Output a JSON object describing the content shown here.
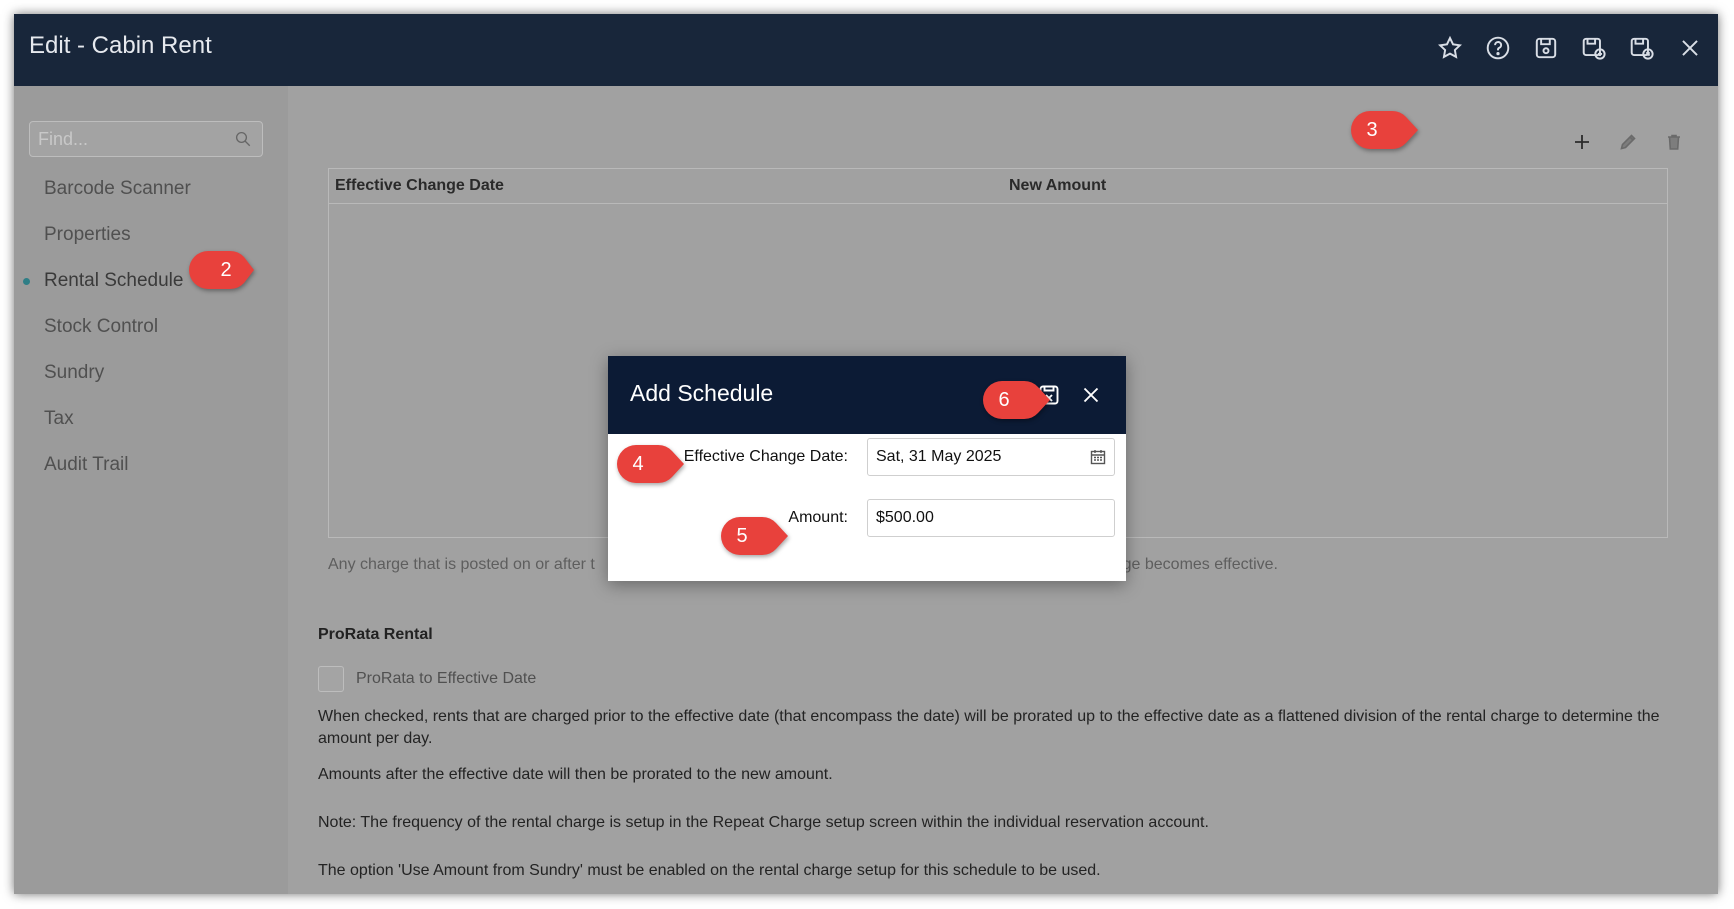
{
  "window": {
    "title": "Edit - Cabin Rent",
    "icons": [
      "star-icon",
      "help-icon",
      "save-icon",
      "save-and-new-icon",
      "save-and-close-icon",
      "close-icon"
    ]
  },
  "sidebar": {
    "search": {
      "placeholder": "Find...",
      "value": ""
    },
    "items": [
      {
        "label": "Barcode Scanner",
        "active": false
      },
      {
        "label": "Properties",
        "active": false
      },
      {
        "label": "Rental Schedule",
        "active": true
      },
      {
        "label": "Stock Control",
        "active": false
      },
      {
        "label": "Sundry",
        "active": false
      },
      {
        "label": "Tax",
        "active": false
      },
      {
        "label": "Audit Trail",
        "active": false
      }
    ]
  },
  "schedule_table": {
    "columns": [
      "Effective Change Date",
      "New Amount"
    ],
    "rows": [],
    "hint_left": "Any charge that is posted on or after t",
    "hint_right": "ent charge becomes effective."
  },
  "prorata": {
    "section_title": "ProRata Rental",
    "checkbox_label": "ProRata to Effective Date",
    "checked": false,
    "description": "When checked, rents that are charged prior to the effective date (that encompass the date) will be prorated up to the effective date as a flattened division of the rental charge to determine the amount per day.",
    "after_note": "Amounts after the effective date will then be prorated to the new amount.",
    "frequency_note": "Note: The frequency of the rental charge is setup in the Repeat Charge setup screen within the individual reservation account.",
    "sundry_note": "The option 'Use Amount from Sundry' must be enabled on the rental charge setup for this schedule to be used."
  },
  "modal": {
    "title": "Add Schedule",
    "date_label": "Effective Change Date:",
    "date_value": "Sat, 31 May 2025",
    "amount_label": "Amount:",
    "amount_value": "$500.00"
  },
  "callouts": {
    "c2": "2",
    "c3": "3",
    "c4": "4",
    "c5": "5",
    "c6": "6"
  },
  "colors": {
    "titlebar": "#18263a",
    "modal_header": "#0c1b35",
    "callout": "#e8413c",
    "active_dot": "#2f7e86"
  }
}
